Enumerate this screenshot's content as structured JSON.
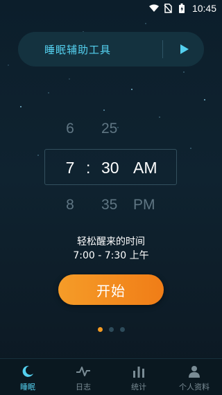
{
  "status_bar": {
    "time": "10:45"
  },
  "banner": {
    "title": "睡眠辅助工具",
    "play_icon": "play-icon"
  },
  "time_picker": {
    "above": {
      "hour": "6",
      "minute": "25"
    },
    "selected": {
      "hour": "7",
      "separator": ":",
      "minute": "30",
      "period": "AM"
    },
    "below": {
      "hour": "8",
      "minute": "35",
      "period": "PM"
    }
  },
  "caption": {
    "line1": "轻松醒来的时间",
    "line2": "7:00 - 7:30 上午"
  },
  "start_button": {
    "label": "开始"
  },
  "pager": {
    "count": 3,
    "active_index": 0
  },
  "tabs": [
    {
      "label": "睡眠",
      "icon": "moon-icon",
      "active": true
    },
    {
      "label": "日志",
      "icon": "pulse-icon",
      "active": false
    },
    {
      "label": "统计",
      "icon": "bar-chart-icon",
      "active": false
    },
    {
      "label": "个人资料",
      "icon": "person-icon",
      "active": false
    }
  ],
  "colors": {
    "accent": "#54d0ef",
    "button": "#f39a22",
    "background": "#0f2330"
  }
}
